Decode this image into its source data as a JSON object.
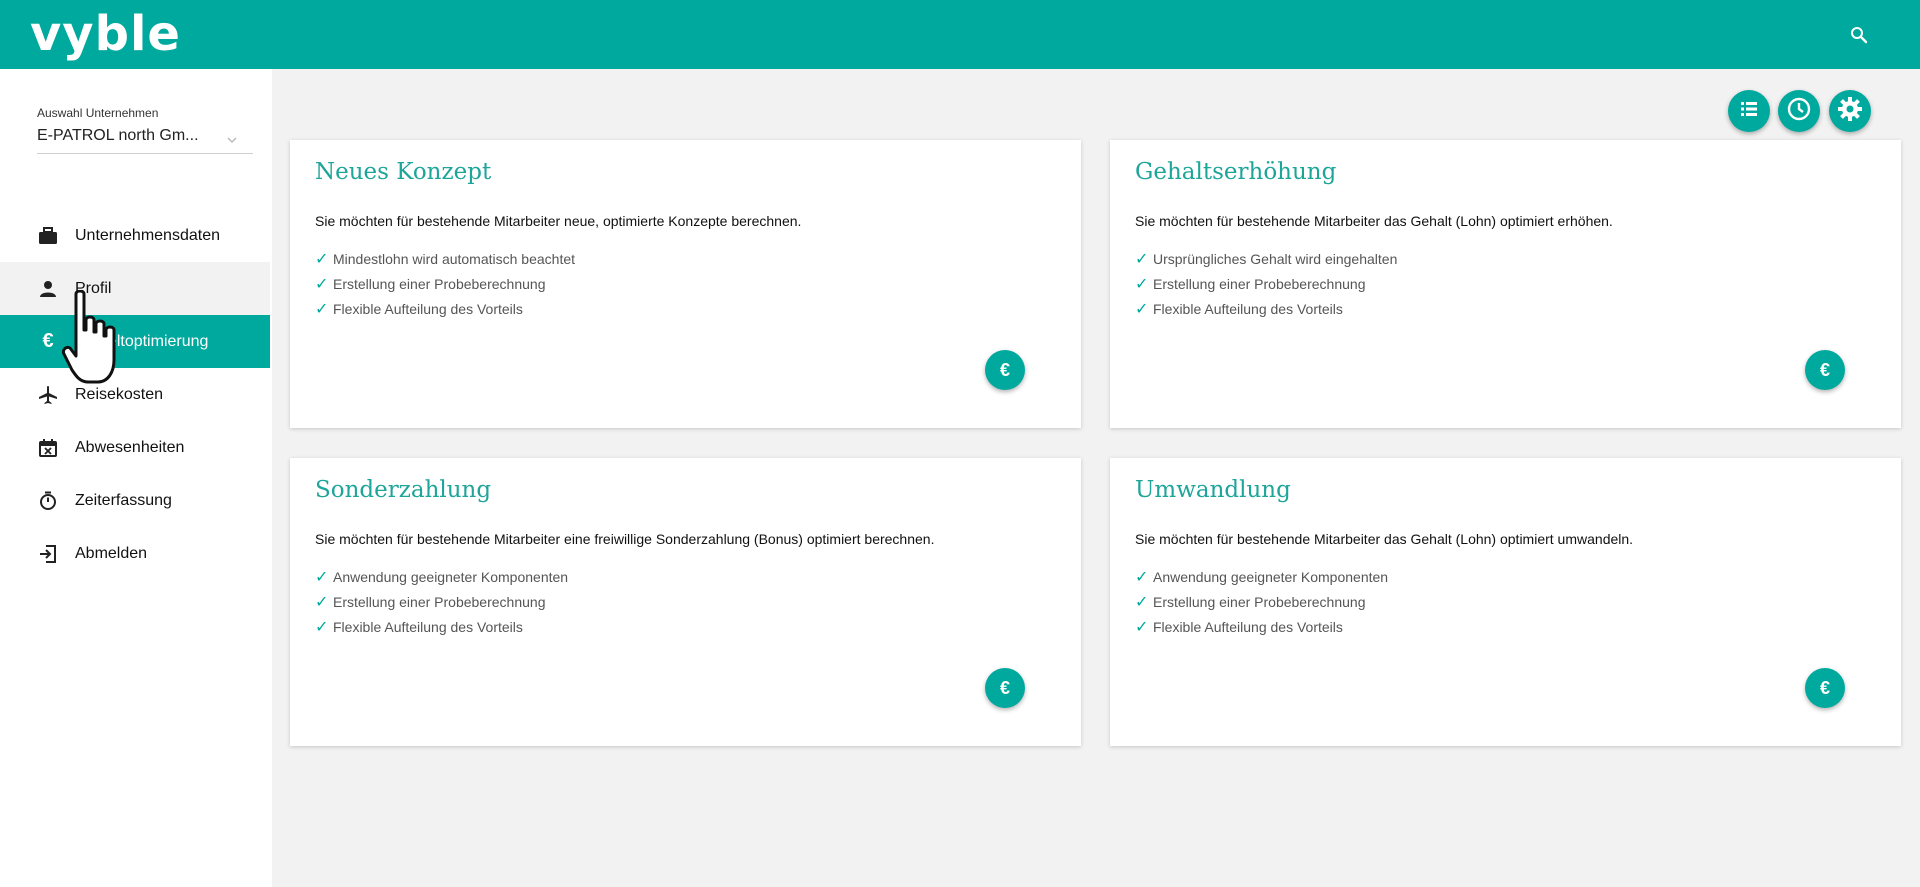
{
  "app": {
    "logo": "vyble"
  },
  "company": {
    "label": "Auswahl Unternehmen",
    "value": "E-PATROL north Gm..."
  },
  "nav": {
    "items": [
      {
        "label": "Unternehmensdaten",
        "icon": "briefcase-icon"
      },
      {
        "label": "Profil",
        "icon": "person-icon"
      },
      {
        "label": "Entgeltoptimierung",
        "icon": "euro-icon"
      },
      {
        "label": "Reisekosten",
        "icon": "airplane-icon"
      },
      {
        "label": "Abwesenheiten",
        "icon": "calendar-x-icon"
      },
      {
        "label": "Zeiterfassung",
        "icon": "stopwatch-icon"
      },
      {
        "label": "Abmelden",
        "icon": "logout-icon"
      }
    ]
  },
  "toolbar": {
    "icons": [
      "list-icon",
      "clock-icon",
      "gear-icon"
    ]
  },
  "cards": [
    {
      "title": "Neues Konzept",
      "description": "Sie möchten für bestehende Mitarbeiter neue, optimierte Konzepte berechnen.",
      "features": [
        "Mindestlohn wird automatisch beachtet",
        "Erstellung einer Probeberechnung",
        "Flexible Aufteilung des Vorteils"
      ],
      "button": "€"
    },
    {
      "title": "Gehaltserhöhung",
      "description": "Sie möchten für bestehende Mitarbeiter das Gehalt (Lohn) optimiert erhöhen.",
      "features": [
        "Ursprüngliches Gehalt wird eingehalten",
        "Erstellung einer Probeberechnung",
        "Flexible Aufteilung des Vorteils"
      ],
      "button": "€"
    },
    {
      "title": "Sonderzahlung",
      "description": "Sie möchten für bestehende Mitarbeiter eine freiwillige Sonderzahlung (Bonus) optimiert berechnen.",
      "features": [
        "Anwendung geeigneter Komponenten",
        "Erstellung einer Probeberechnung",
        "Flexible Aufteilung des Vorteils"
      ],
      "button": "€"
    },
    {
      "title": "Umwandlung",
      "description": "Sie möchten für bestehende Mitarbeiter das Gehalt (Lohn) optimiert umwandeln.",
      "features": [
        "Anwendung geeigneter Komponenten",
        "Erstellung einer Probeberechnung",
        "Flexible Aufteilung des Vorteils"
      ],
      "button": "€"
    }
  ],
  "colors": {
    "accent": "#00a99d",
    "title": "#1ea59a",
    "background": "#f2f2f2"
  }
}
